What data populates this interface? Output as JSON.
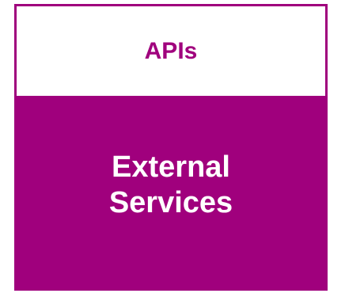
{
  "colors": {
    "accent": "#a0007d",
    "background": "#ffffff",
    "body_text": "#ffffff"
  },
  "component": {
    "header": "APIs",
    "body_lines": [
      "External",
      "Services"
    ]
  }
}
